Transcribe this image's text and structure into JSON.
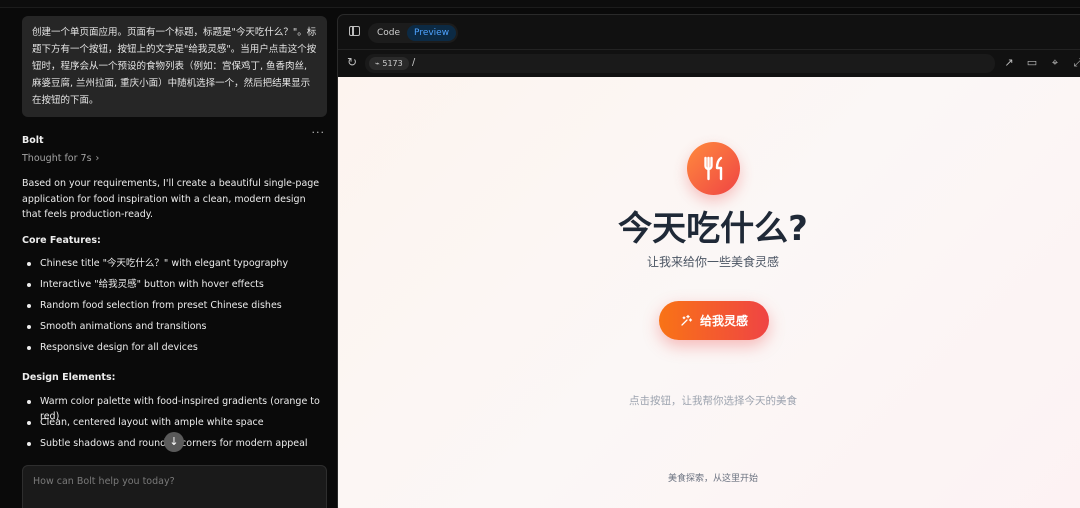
{
  "chat": {
    "user_message": "创建一个单页面应用。页面有一个标题，标题是\"今天吃什么？\"。标题下方有一个按钮，按钮上的文字是\"给我灵感\"。当用户点击这个按钮时，程序会从一个预设的食物列表（例如：宫保鸡丁, 鱼香肉丝, 麻婆豆腐, 兰州拉面, 重庆小面）中随机选择一个，然后把结果显示在按钮的下面。",
    "assistant_name": "Bolt",
    "more_label": "···",
    "thought_label": "Thought for 7s",
    "intro": "Based on your requirements, I'll create a beautiful single-page application for food inspiration with a clean, modern design that feels production-ready.",
    "core_heading": "Core Features:",
    "core_features": [
      "Chinese title \"今天吃什么？\" with elegant typography",
      "Interactive \"给我灵感\" button with hover effects",
      "Random food selection from preset Chinese dishes",
      "Smooth animations and transitions",
      "Responsive design for all devices"
    ],
    "design_heading": "Design Elements:",
    "design_elements": [
      "Warm color palette with food-inspired gradients (orange to red)",
      "Clean, centered layout with ample white space",
      "Subtle shadows and rounded corners for modern appeal"
    ],
    "prompt_placeholder": "How can Bolt help you today?"
  },
  "workbench": {
    "tabs": [
      "Code",
      "Preview"
    ],
    "active_tab": "Preview",
    "port": "5173",
    "path": "/"
  },
  "app": {
    "title": "今天吃什么?",
    "subtitle": "让我来给你一些美食灵感",
    "button_label": "给我灵感",
    "hint": "点击按钮，让我帮你选择今天的美食",
    "footer": "美食探索，从这里开始"
  },
  "colors": {
    "accent_start": "#f97316",
    "accent_end": "#ef4444",
    "tab_active": "#4fa3ff"
  }
}
